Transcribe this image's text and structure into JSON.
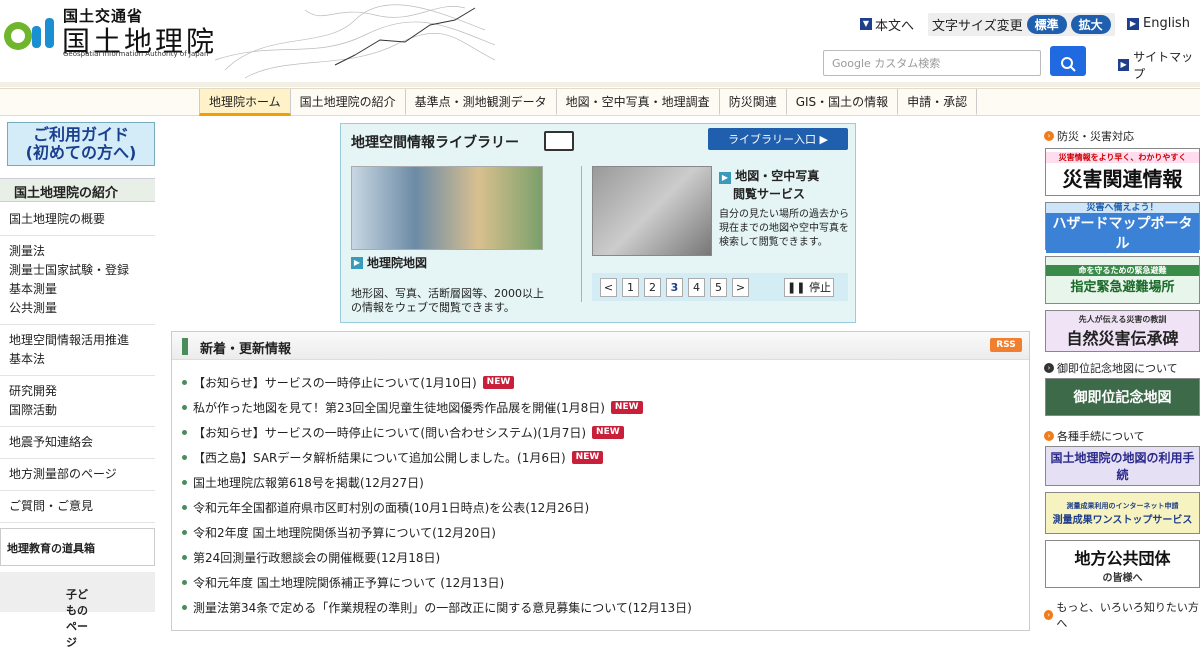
{
  "header": {
    "org_name_jp": "国土交通省",
    "org_name_big": "国土地理院",
    "org_name_en": "Geospatial Information Authority of Japan",
    "skip_link": "本文へ",
    "font_size_label": "文字サイズ変更",
    "font_standard": "標準",
    "font_large": "拡大",
    "english": "English",
    "search_placeholder": "Google カスタム検索",
    "sitemap": "サイトマップ"
  },
  "gnav": [
    "地理院ホーム",
    "国土地理院の紹介",
    "基準点・測地観測データ",
    "地図・空中写真・地理調査",
    "防災関連",
    "GIS・国土の情報",
    "申請・承認"
  ],
  "left": {
    "guide_line1": "ご利用ガイド",
    "guide_line2": "(初めての方へ)",
    "intro_heading": "国土地理院の紹介",
    "intro_items": [
      {
        "lines": [
          "国土地理院の概要"
        ]
      },
      {
        "lines": [
          "測量法",
          "測量士国家試験・登録",
          "基本測量",
          "公共測量"
        ]
      },
      {
        "lines": [
          "地理空間情報活用推進",
          "基本法"
        ]
      },
      {
        "lines": [
          "研究開発",
          "国際活動"
        ]
      },
      {
        "lines": [
          "地震予知連絡会"
        ]
      },
      {
        "lines": [
          "地方測量部のページ"
        ]
      },
      {
        "lines": [
          "ご質問・ご意見"
        ]
      }
    ],
    "edu_banner": "地理教育の道具箱",
    "kids_banner": "子どものページ"
  },
  "library": {
    "title": "地理空間情報ライブラリー",
    "enter": "ライブラリー入口",
    "item1_title": "地理院地図",
    "item1_desc": "地形図、写真、活断層図等、2000以上の情報をウェブで閲覧できます。",
    "item2_title_l1": "地図・空中写真",
    "item2_title_l2": "閲覧サービス",
    "item2_desc": "自分の見たい場所の過去から現在までの地図や空中写真を検索して閲覧できます。",
    "pager": [
      "<",
      "1",
      "2",
      "3",
      "4",
      "5",
      ">"
    ],
    "pager_active": "3",
    "stop": "停止"
  },
  "news": {
    "title": "新着・更新情報",
    "rss": "RSS",
    "new_label": "NEW",
    "items": [
      {
        "text": "【お知らせ】サービスの一時停止について(1月10日)",
        "is_new": true
      },
      {
        "text": "私が作った地図を見て！第23回全国児童生徒地図優秀作品展を開催(1月8日)",
        "is_new": true
      },
      {
        "text": "【お知らせ】サービスの一時停止について(問い合わせシステム)(1月7日)",
        "is_new": true
      },
      {
        "text": "【西之島】SARデータ解析結果について追加公開しました。(1月6日)",
        "is_new": true
      },
      {
        "text": "国土地理院広報第618号を掲載(12月27日)",
        "is_new": false
      },
      {
        "text": "令和元年全国都道府県市区町村別の面積(10月1日時点)を公表(12月26日)",
        "is_new": false
      },
      {
        "text": "令和2年度 国土地理院関係当初予算について(12月20日)",
        "is_new": false
      },
      {
        "text": "第24回測量行政懇談会の開催概要(12月18日)",
        "is_new": false
      },
      {
        "text": "令和元年度 国土地理院関係補正予算について (12月13日)",
        "is_new": false
      },
      {
        "text": "測量法第34条で定める「作業規程の準則」の一部改正に関する意見募集について(12月13日)",
        "is_new": false
      }
    ]
  },
  "right": {
    "sec1": "防災・災害対応",
    "b1_small": "災害情報をより早く、わかりやすく",
    "b1_big": "災害関連情報",
    "b2_small": "災害へ備えよう！",
    "b2_big": "ハザードマップポータル",
    "b3_small": "命を守るための緊急避難",
    "b3_big": "指定緊急避難場所",
    "b4_small": "先人が伝える災害の教訓",
    "b4_big": "自然災害伝承碑",
    "sec2": "御即位記念地図について",
    "b5": "御即位記念地図",
    "sec3": "各種手続について",
    "b6": "国土地理院の地図の利用手続",
    "b7_small": "測量成果利用のインターネット申請",
    "b7_big": "測量成果ワンストップサービス",
    "b8_big": "地方公共団体",
    "b8_small": "の皆様へ",
    "sec4": "もっと、いろいろ知りたい方へ"
  },
  "colors": {
    "accent_blue": "#1f5fae",
    "nav_active": "#f0a000",
    "new_red": "#c8203a",
    "rss_orange": "#f08030",
    "news_green": "#4a8c5a"
  }
}
